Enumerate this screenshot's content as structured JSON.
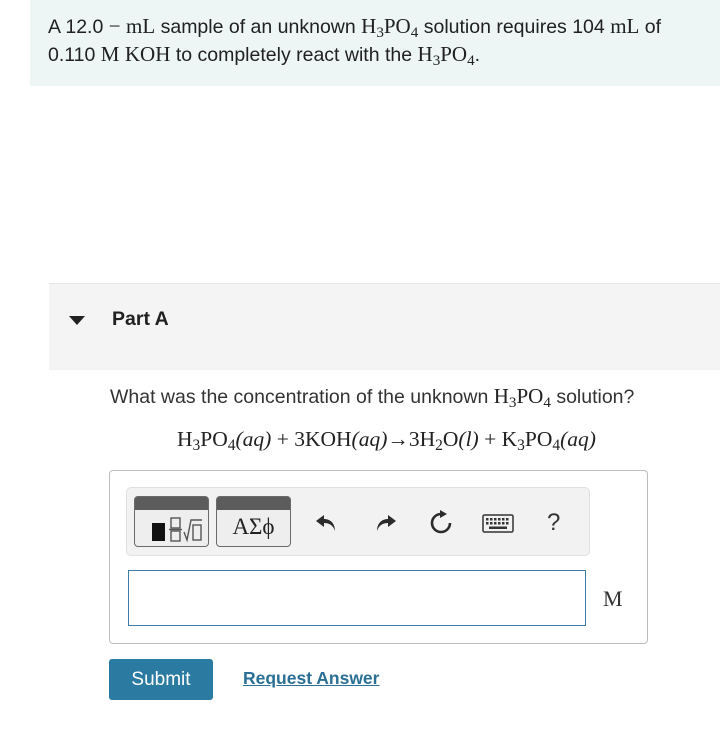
{
  "problem": {
    "p1": "A 12.0",
    "dash": "−",
    "ml1": "mL",
    "p2": "sample of an unknown",
    "h": "H",
    "h_sub": "3",
    "po": "PO",
    "po_sub": "4",
    "p3": "solution requires 104",
    "ml2": "mL",
    "p4": "of",
    "conc_num": "0.110",
    "conc_unit": "M",
    "base": "KOH",
    "p5": "to completely react with the",
    "h2": "H",
    "h2_sub": "3",
    "po2": "PO",
    "po2_sub": "4",
    "end": "."
  },
  "part": {
    "title": "Part A",
    "question_pre": "What was the concentration of the unknown",
    "q_h": "H",
    "q_h_sub": "3",
    "q_po": "PO",
    "q_po_sub": "4",
    "question_post": "solution?"
  },
  "equation": {
    "a1": "H",
    "a1_sub": "3",
    "a2": "PO",
    "a2_sub": "4",
    "a3": "(aq)",
    "plus1": "+",
    "b1": "3KOH",
    "b2": "(aq)",
    "arrow": "→",
    "c1": "3H",
    "c1_sub": "2",
    "c2": "O",
    "c3": "(l)",
    "plus2": "+",
    "d1": "K",
    "d1_sub": "3",
    "d2": "PO",
    "d2_sub": "4",
    "d3": "(aq)"
  },
  "toolbar": {
    "templates_icon": "templates-icon",
    "greek_label": "AΣϕ",
    "undo_icon": "undo-icon",
    "redo_icon": "redo-icon",
    "reset_icon": "reset-icon",
    "keyboard_icon": "keyboard-icon",
    "help_label": "?"
  },
  "answer": {
    "value": "",
    "unit": "M"
  },
  "actions": {
    "submit": "Submit",
    "request": "Request Answer"
  },
  "colors": {
    "banner_bg": "#edf5f5",
    "submit_bg": "#2a7aa1",
    "link": "#2a6f95",
    "input_border": "#3a7ca5"
  }
}
